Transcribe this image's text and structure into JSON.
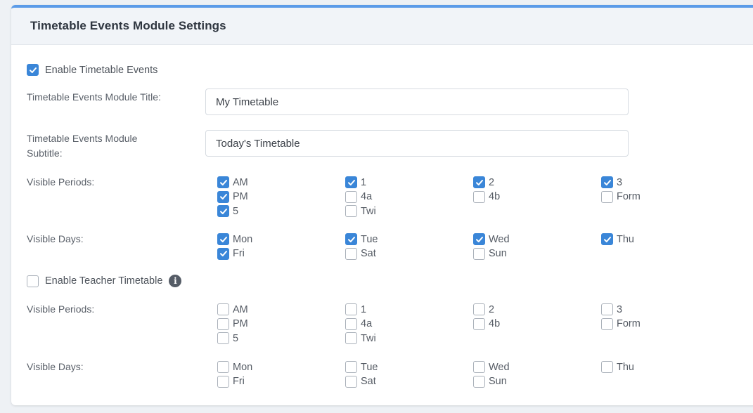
{
  "title": "Timetable Events Module Settings",
  "enable_timetable_events": {
    "label": "Enable Timetable Events",
    "checked": true
  },
  "module_title": {
    "label": "Timetable Events Module Title:",
    "value": "My Timetable"
  },
  "module_subtitle": {
    "label_line1": "Timetable Events Module",
    "label_line2": "Subtitle:",
    "value": "Today's Timetable"
  },
  "student_periods": {
    "label": "Visible Periods:",
    "options": [
      {
        "label": "AM",
        "checked": true
      },
      {
        "label": "1",
        "checked": true
      },
      {
        "label": "2",
        "checked": true
      },
      {
        "label": "3",
        "checked": true
      },
      {
        "label": "PM",
        "checked": true
      },
      {
        "label": "4a",
        "checked": false
      },
      {
        "label": "4b",
        "checked": false
      },
      {
        "label": "Form",
        "checked": false
      },
      {
        "label": "5",
        "checked": true
      },
      {
        "label": "Twi",
        "checked": false
      }
    ]
  },
  "student_days": {
    "label": "Visible Days:",
    "options": [
      {
        "label": "Mon",
        "checked": true
      },
      {
        "label": "Tue",
        "checked": true
      },
      {
        "label": "Wed",
        "checked": true
      },
      {
        "label": "Thu",
        "checked": true
      },
      {
        "label": "Fri",
        "checked": true
      },
      {
        "label": "Sat",
        "checked": false
      },
      {
        "label": "Sun",
        "checked": false
      }
    ]
  },
  "enable_teacher_timetable": {
    "label": "Enable Teacher Timetable",
    "checked": false,
    "info_icon": "info-icon"
  },
  "teacher_periods": {
    "label": "Visible Periods:",
    "options": [
      {
        "label": "AM",
        "checked": false
      },
      {
        "label": "1",
        "checked": false
      },
      {
        "label": "2",
        "checked": false
      },
      {
        "label": "3",
        "checked": false
      },
      {
        "label": "PM",
        "checked": false
      },
      {
        "label": "4a",
        "checked": false
      },
      {
        "label": "4b",
        "checked": false
      },
      {
        "label": "Form",
        "checked": false
      },
      {
        "label": "5",
        "checked": false
      },
      {
        "label": "Twi",
        "checked": false
      }
    ]
  },
  "teacher_days": {
    "label": "Visible Days:",
    "options": [
      {
        "label": "Mon",
        "checked": false
      },
      {
        "label": "Tue",
        "checked": false
      },
      {
        "label": "Wed",
        "checked": false
      },
      {
        "label": "Thu",
        "checked": false
      },
      {
        "label": "Fri",
        "checked": false
      },
      {
        "label": "Sat",
        "checked": false
      },
      {
        "label": "Sun",
        "checked": false
      }
    ]
  },
  "colors": {
    "accent": "#3a86d8",
    "header_bar": "#5b9be8"
  }
}
